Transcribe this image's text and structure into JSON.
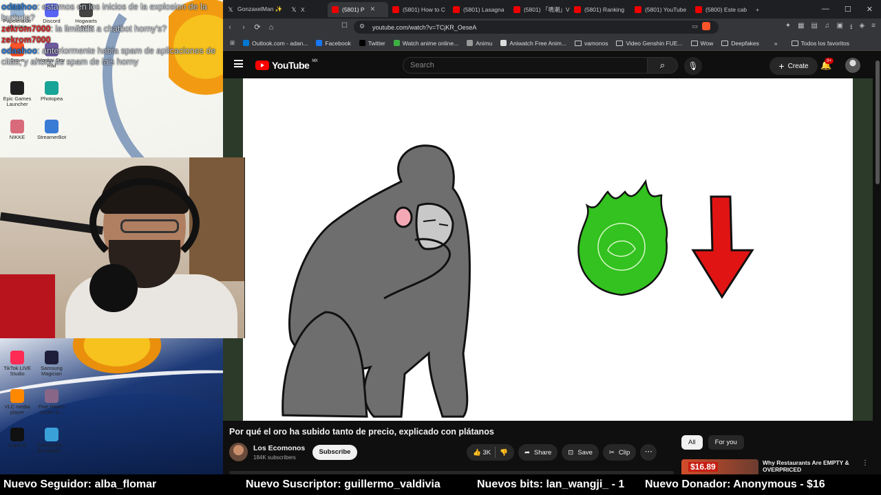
{
  "stream_chat": [
    {
      "user": "odashoo",
      "text": "estamos en los inicios de la explosion de la burbuja?"
    },
    {
      "user": "zekrom7000",
      "text": "la limitada a chatbot horny's?"
    },
    {
      "user": "zekrom7000",
      "text": ""
    },
    {
      "user": "odashoo",
      "text": "anteriormente habia spam de aplicaciones de citas, y ahora es spam de ia's horny"
    }
  ],
  "desktop_icons": [
    {
      "label": "Papelera de reciclaje",
      "color": "#9bb7d6"
    },
    {
      "label": "Discord",
      "color": "#5865f2"
    },
    {
      "label": "Hogwarts Legacy",
      "color": "#444"
    },
    {
      "label": "Brave",
      "color": "#fb542b"
    },
    {
      "label": "Honkai Star Rail",
      "color": "#6d5b9e"
    },
    {
      "label": "Epic Games Launcher",
      "color": "#222"
    },
    {
      "label": "Photopea",
      "color": "#18a497"
    },
    {
      "label": "NIKKE",
      "color": "#d86a7a"
    },
    {
      "label": "StreamerBot",
      "color": "#3a7bd5"
    },
    {
      "label": "TikTok LIVE Studio",
      "color": "#fe2c55"
    },
    {
      "label": "Samsung Magician",
      "color": "#1e1e3a"
    },
    {
      "label": "VLC media player",
      "color": "#ff8800"
    },
    {
      "label": "Five Hearts Under O...",
      "color": "#886688"
    },
    {
      "label": "CapCut",
      "color": "#111"
    },
    {
      "label": "Comproba... de estado ...",
      "color": "#3aa0d8"
    }
  ],
  "browser": {
    "tabs": [
      {
        "label": "GonzaxelMan ✨",
        "type": "x"
      },
      {
        "label": "X",
        "type": "x"
      },
      {
        "label": "(5801) P",
        "type": "yt",
        "active": true
      },
      {
        "label": "(5801) How to C",
        "type": "yt"
      },
      {
        "label": "(5801) Lasagna",
        "type": "yt"
      },
      {
        "label": "(5801) 「鳴潮」V",
        "type": "yt"
      },
      {
        "label": "(5801) Ranking",
        "type": "yt"
      },
      {
        "label": "(5801) YouTube",
        "type": "yt"
      },
      {
        "label": "(5800) Este cab",
        "type": "yt"
      }
    ],
    "new_tab": "+",
    "url": "youtube.com/watch?v=TCjKR_OeseA",
    "bookmarks": [
      {
        "label": "Outlook.com - adan...",
        "kind": "ms"
      },
      {
        "label": "Facebook",
        "kind": "fb"
      },
      {
        "label": "Twitter",
        "kind": "x"
      },
      {
        "label": "Watch anime online...",
        "kind": "anime"
      },
      {
        "label": "Animu",
        "kind": "globe"
      },
      {
        "label": "Aniwatch Free Anim...",
        "kind": "aw"
      },
      {
        "label": "vamonos",
        "kind": "folder"
      },
      {
        "label": "Video Genshin FUE...",
        "kind": "folder"
      },
      {
        "label": "Wow",
        "kind": "folder"
      },
      {
        "label": "Deepfakes",
        "kind": "folder"
      }
    ],
    "all_bookmarks": "Todos los favoritos"
  },
  "youtube": {
    "logo_text": "YouTube",
    "region": "MX",
    "search_placeholder": "Search",
    "create_label": "Create",
    "notif_badge": "9+",
    "video_title": "Por qué el oro ha subido tanto de precio, explicado con plátanos",
    "channel_name": "Los Ecomonos",
    "channel_subs": "184K subscribers",
    "subscribe_label": "Subscribe",
    "likes": "3K",
    "share_label": "Share",
    "save_label": "Save",
    "clip_label": "Clip",
    "chips": [
      "All",
      "For you"
    ],
    "rec_price": "$16.89",
    "rec_title": "Why Restaurants Are EMPTY & OVERPRICED"
  },
  "ticker": {
    "follower": "Nuevo Seguidor: alba_flomar",
    "subscriber": "Nuevo Suscriptor: guillermo_valdivia",
    "bits": "Nuevos bits: lan_wangji_ - 1",
    "donor": "Nuevo Donador: Anonymous - $16"
  }
}
